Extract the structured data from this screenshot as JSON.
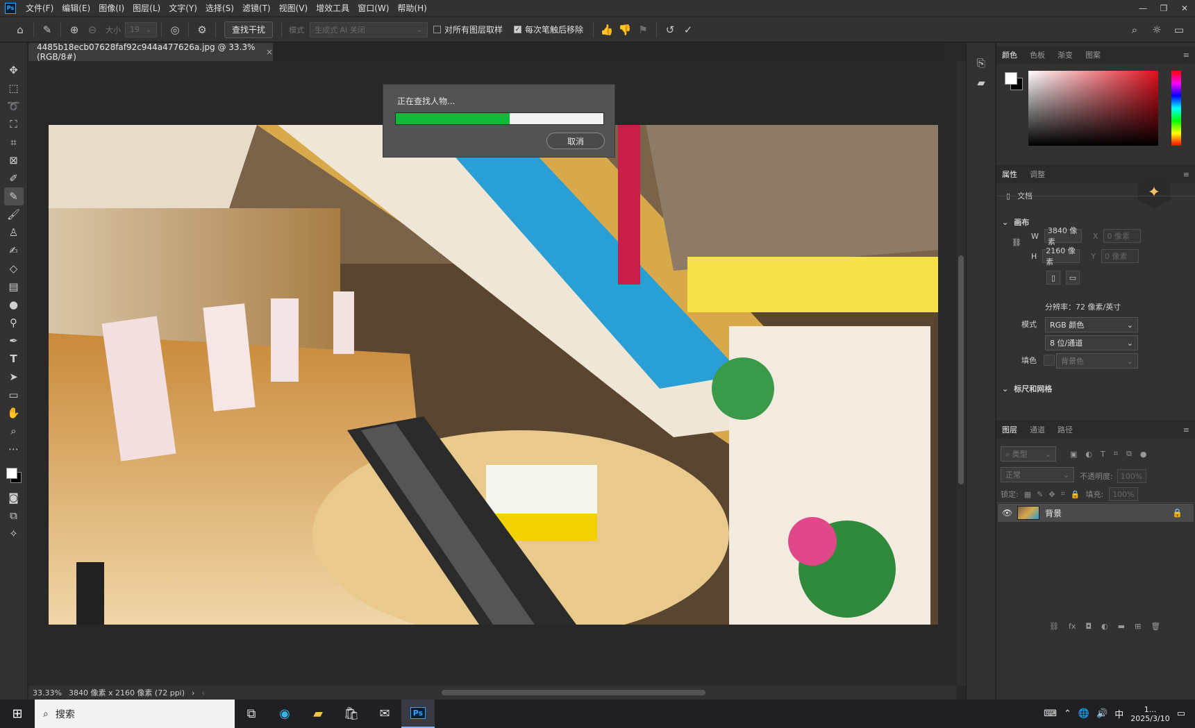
{
  "app": {
    "logo": "Ps"
  },
  "menu": [
    "文件(F)",
    "编辑(E)",
    "图像(I)",
    "图层(L)",
    "文字(Y)",
    "选择(S)",
    "滤镜(T)",
    "视图(V)",
    "增效工具",
    "窗口(W)",
    "帮助(H)"
  ],
  "window_controls": {
    "minimize": "—",
    "restore": "❐",
    "close": "✕"
  },
  "options": {
    "size_label": "大小",
    "size_value": "19",
    "find_button": "查找干扰",
    "mode_label": "模式",
    "mode_value": "生成式 AI 关闭",
    "sample_all_layers": {
      "label": "对所有图层取样",
      "checked": false
    },
    "remove_after_stroke": {
      "label": "每次笔触后移除",
      "checked": true
    }
  },
  "document": {
    "tab_title": "4485b18ecb07628faf92c944a477626a.jpg @ 33.3%(RGB/8#)",
    "close": "×"
  },
  "progress_dialog": {
    "title": "正在查找人物...",
    "progress_percent": 55,
    "cancel_label": "取消"
  },
  "status": {
    "zoom": "33.33%",
    "info": "3840 像素 x 2160 像素 (72 ppi)"
  },
  "color_panel": {
    "tabs": [
      "颜色",
      "色板",
      "渐变",
      "图案"
    ],
    "active_tab": "颜色",
    "foreground": "#ffffff",
    "background": "#000000",
    "hue_color": "#e0101e"
  },
  "properties_panel": {
    "tabs": [
      "属性",
      "调整"
    ],
    "active_tab": "属性",
    "doc_label": "文档",
    "canvas_section": "画布",
    "w_label": "W",
    "w_value": "3840 像素",
    "h_label": "H",
    "h_value": "2160 像素",
    "x_label": "X",
    "x_value": "0 像素",
    "y_label": "Y",
    "y_value": "0 像素",
    "resolution": "分辨率：72 像素/英寸",
    "mode_label": "模式",
    "mode_value": "RGB 颜色",
    "depth_value": "8 位/通道",
    "fill_label": "填色",
    "fill_value": "背景色",
    "rulers_section": "标尺和网格"
  },
  "layers_panel": {
    "tabs": [
      "图层",
      "通道",
      "路径"
    ],
    "active_tab": "图层",
    "filter_label": "类型",
    "blend_mode": "正常",
    "opacity_label": "不透明度:",
    "opacity_value": "100%",
    "lock_label": "锁定:",
    "fill_label": "填充:",
    "fill_value": "100%",
    "layers": [
      {
        "name": "背景",
        "visible": true,
        "locked": true
      }
    ]
  },
  "taskbar": {
    "search_placeholder": "搜索",
    "ime": "中",
    "date": "2025/3/10",
    "time": "1..."
  }
}
